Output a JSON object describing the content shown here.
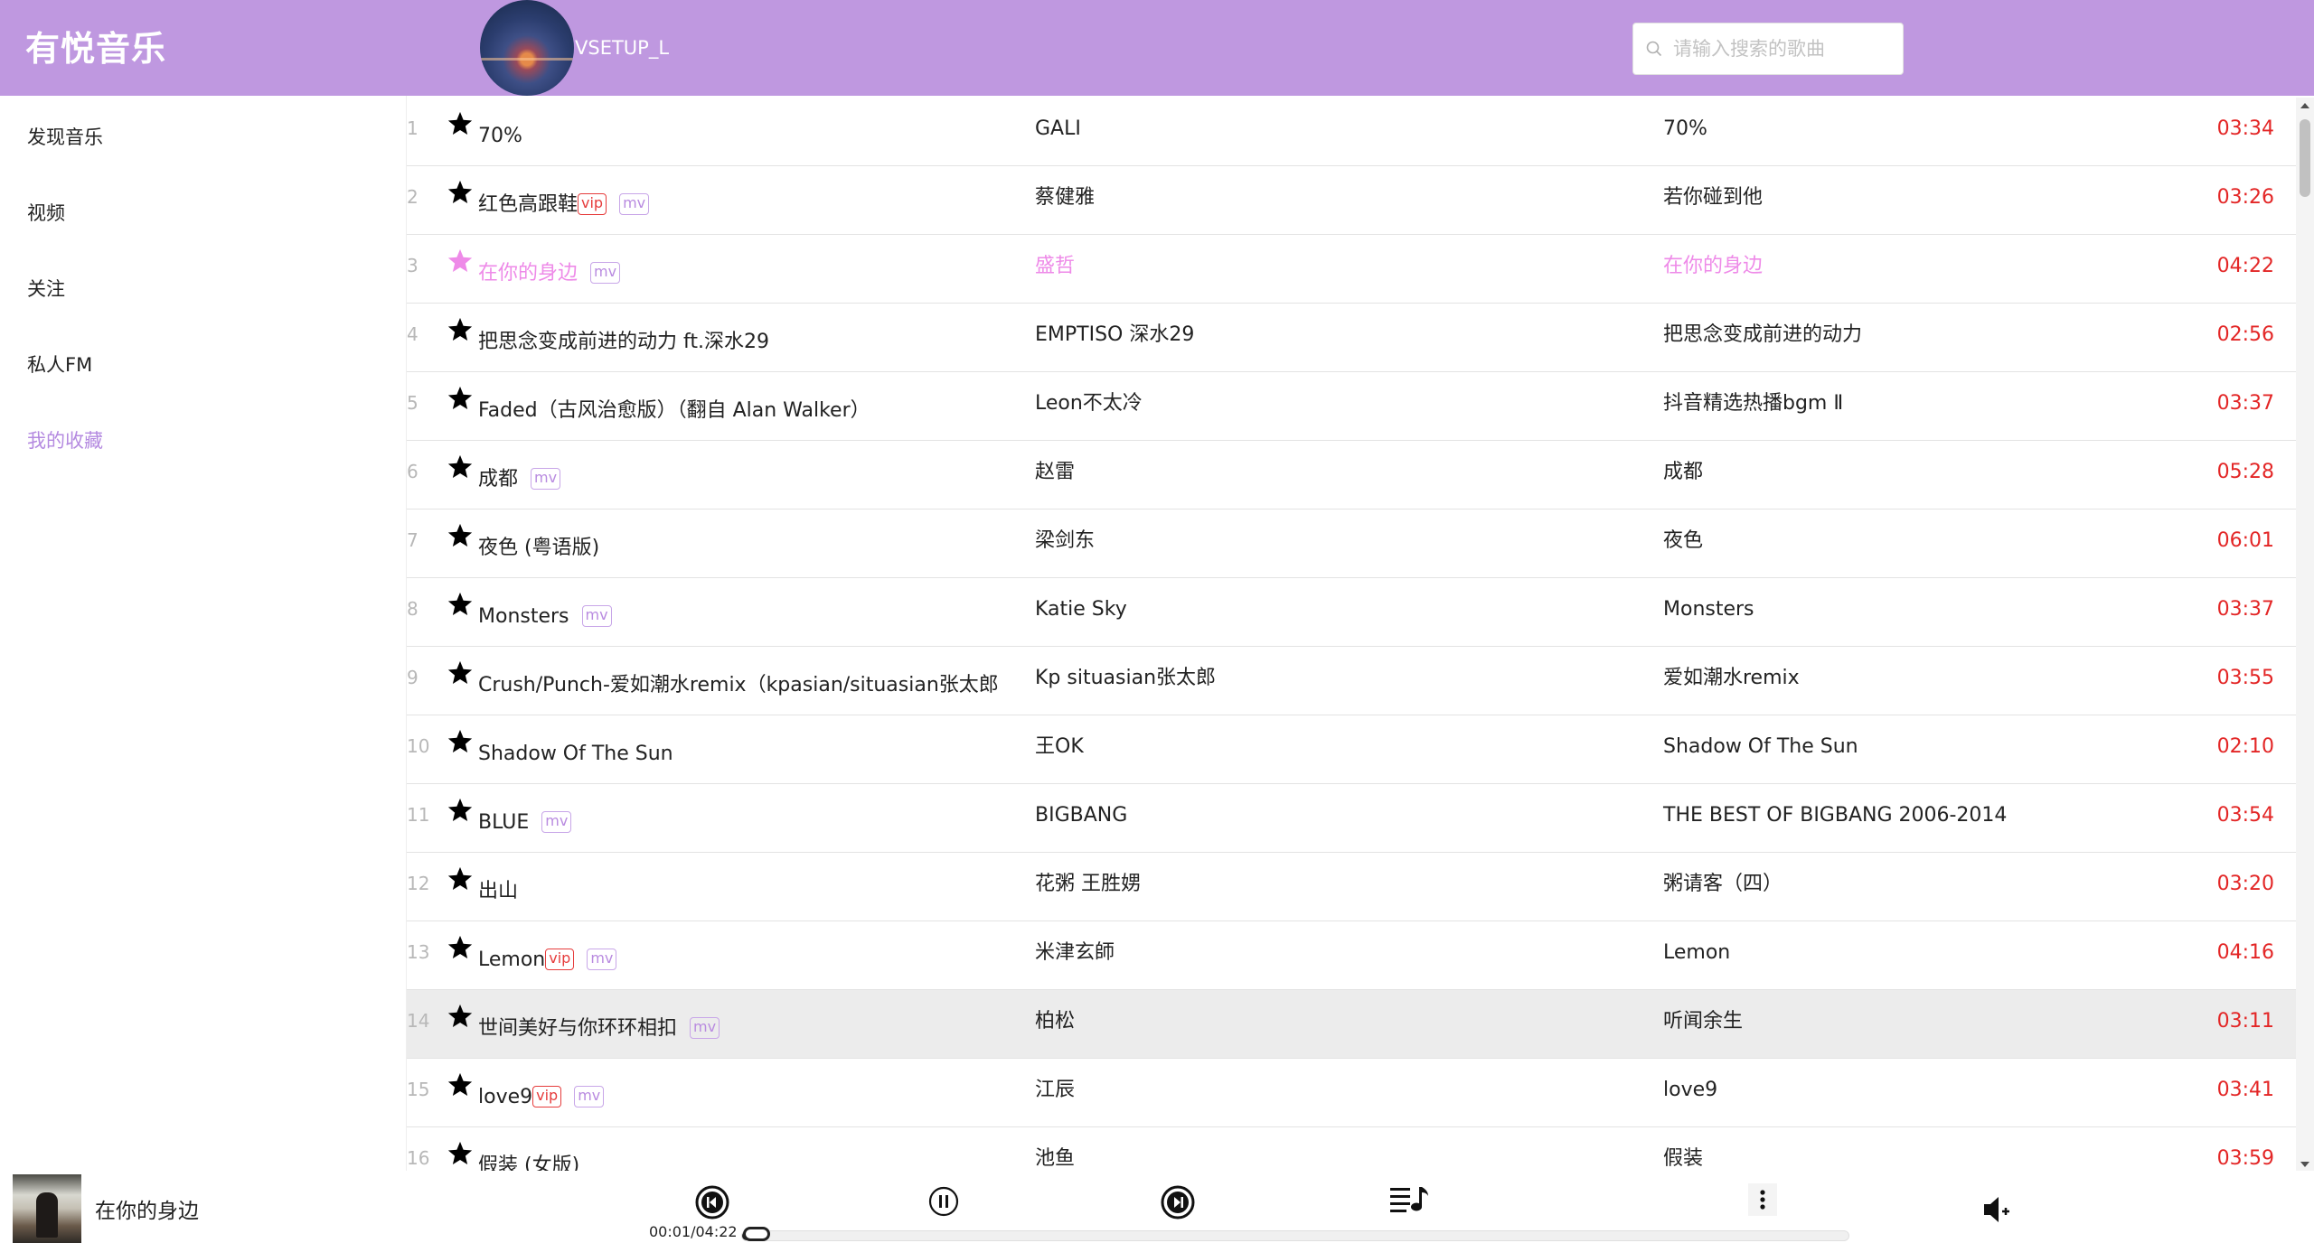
{
  "app": {
    "logo": "有悦音乐",
    "username": "VSETUP_L"
  },
  "search": {
    "placeholder": "请输入搜索的歌曲",
    "value": ""
  },
  "colors": {
    "header_bg": "#bf98e0",
    "accent": "#b48ae0",
    "playing": "#ee8ae8",
    "duration": "#e32626"
  },
  "sidebar": {
    "items": [
      {
        "label": "发现音乐",
        "active": false
      },
      {
        "label": "视频",
        "active": false
      },
      {
        "label": "关注",
        "active": false
      },
      {
        "label": "私人FM",
        "active": false
      },
      {
        "label": "我的收藏",
        "active": true
      }
    ]
  },
  "songs": [
    {
      "index": "1",
      "title": "70%",
      "vip": false,
      "mv": false,
      "artist": "GALI",
      "album": "70%",
      "duration": "03:34",
      "state": ""
    },
    {
      "index": "2",
      "title": "红色高跟鞋",
      "vip": true,
      "mv": true,
      "artist": "蔡健雅",
      "album": "若你碰到他",
      "duration": "03:26",
      "state": ""
    },
    {
      "index": "3",
      "title": "在你的身边",
      "vip": false,
      "mv": true,
      "artist": "盛哲",
      "album": "在你的身边",
      "duration": "04:22",
      "state": "playing"
    },
    {
      "index": "4",
      "title": "把思念变成前进的动力 ft.深水29",
      "vip": false,
      "mv": false,
      "artist": "EMPTISO   深水29",
      "album": "把思念变成前进的动力",
      "duration": "02:56",
      "state": ""
    },
    {
      "index": "5",
      "title": "Faded（古风治愈版）（翻自 Alan Walker）",
      "vip": false,
      "mv": false,
      "artist": "Leon不太冷",
      "album": "抖音精选热播bgm Ⅱ",
      "duration": "03:37",
      "state": ""
    },
    {
      "index": "6",
      "title": "成都",
      "vip": false,
      "mv": true,
      "artist": "赵雷",
      "album": "成都",
      "duration": "05:28",
      "state": ""
    },
    {
      "index": "7",
      "title": "夜色 (粤语版)",
      "vip": false,
      "mv": false,
      "artist": "梁剑东",
      "album": "夜色",
      "duration": "06:01",
      "state": ""
    },
    {
      "index": "8",
      "title": "Monsters",
      "vip": false,
      "mv": true,
      "artist": "Katie Sky",
      "album": "Monsters",
      "duration": "03:37",
      "state": ""
    },
    {
      "index": "9",
      "title": "Crush/Punch-爱如潮水remix（kpasian/situasian张太郎",
      "vip": false,
      "mv": false,
      "artist": "Kp   situasian张太郎",
      "album": "爱如潮水remix",
      "duration": "03:55",
      "state": ""
    },
    {
      "index": "10",
      "title": "Shadow Of The Sun",
      "vip": false,
      "mv": false,
      "artist": "王OK",
      "album": "Shadow Of The Sun",
      "duration": "02:10",
      "state": ""
    },
    {
      "index": "11",
      "title": "BLUE",
      "vip": false,
      "mv": true,
      "artist": "BIGBANG",
      "album": "THE BEST OF BIGBANG 2006-2014",
      "duration": "03:54",
      "state": ""
    },
    {
      "index": "12",
      "title": "出山",
      "vip": false,
      "mv": false,
      "artist": "花粥   王胜娚",
      "album": "粥请客（四）",
      "duration": "03:20",
      "state": ""
    },
    {
      "index": "13",
      "title": "Lemon",
      "vip": true,
      "mv": true,
      "artist": "米津玄師",
      "album": "Lemon",
      "duration": "04:16",
      "state": ""
    },
    {
      "index": "14",
      "title": "世间美好与你环环相扣",
      "vip": false,
      "mv": true,
      "artist": "柏松",
      "album": "听闻余生",
      "duration": "03:11",
      "state": "hover"
    },
    {
      "index": "15",
      "title": "love9",
      "vip": true,
      "mv": true,
      "artist": "江辰",
      "album": "love9",
      "duration": "03:41",
      "state": ""
    },
    {
      "index": "16",
      "title": "假装 (女版)",
      "vip": false,
      "mv": false,
      "artist": "池鱼",
      "album": "假装",
      "duration": "03:59",
      "state": ""
    }
  ],
  "badges": {
    "vip": "vip",
    "mv": "mv"
  },
  "player": {
    "now_playing": "在你的身边",
    "time_display": "00:01/04:22",
    "progress": 0.004,
    "icons": [
      "prev-icon",
      "pause-icon",
      "next-icon",
      "playlist-icon",
      "more-icon",
      "volume-icon"
    ]
  }
}
